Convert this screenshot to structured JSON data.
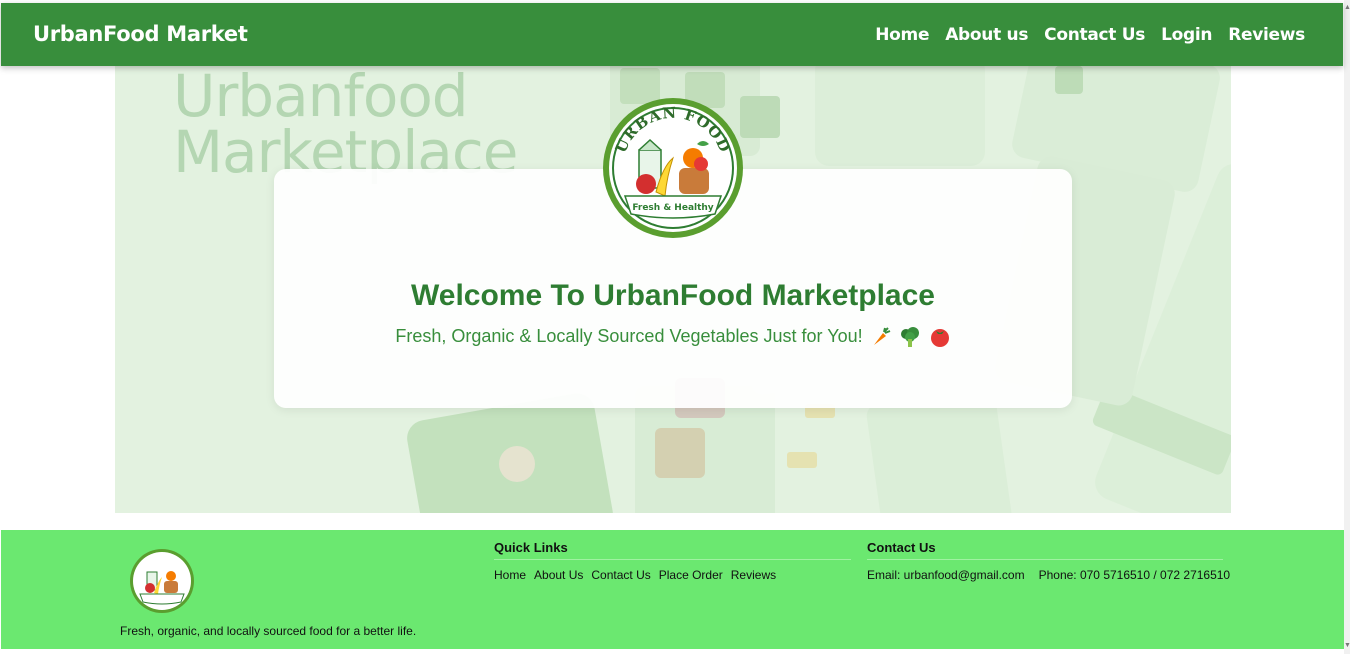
{
  "navbar": {
    "brand": "UrbanFood Market",
    "links": [
      "Home",
      "About us",
      "Contact Us",
      "Login",
      "Reviews"
    ]
  },
  "hero": {
    "background_wordmark": [
      "Urbanfood",
      "Marketplace"
    ],
    "logo_text_top": "URBAN FOOD",
    "logo_text_bottom": "Fresh & Healthy",
    "title": "Welcome To UrbanFood Marketplace",
    "subtitle": "Fresh, Organic & Locally Sourced Vegetables Just for You!",
    "subtitle_icons": [
      "carrot-icon",
      "broccoli-icon",
      "tomato-icon"
    ]
  },
  "footer": {
    "tagline": "Fresh, organic, and locally sourced food for a better life.",
    "quick_links_title": "Quick Links",
    "quick_links": [
      "Home",
      "About Us",
      "Contact Us",
      "Place Order",
      "Reviews"
    ],
    "contact_title": "Contact Us",
    "email": "Email: urbanfood@gmail.com",
    "phone": "Phone: 070 5716510 / 072 2716510"
  },
  "colors": {
    "nav_bg": "#388e3c",
    "footer_bg": "#6be870",
    "title_green": "#2e7d32"
  }
}
